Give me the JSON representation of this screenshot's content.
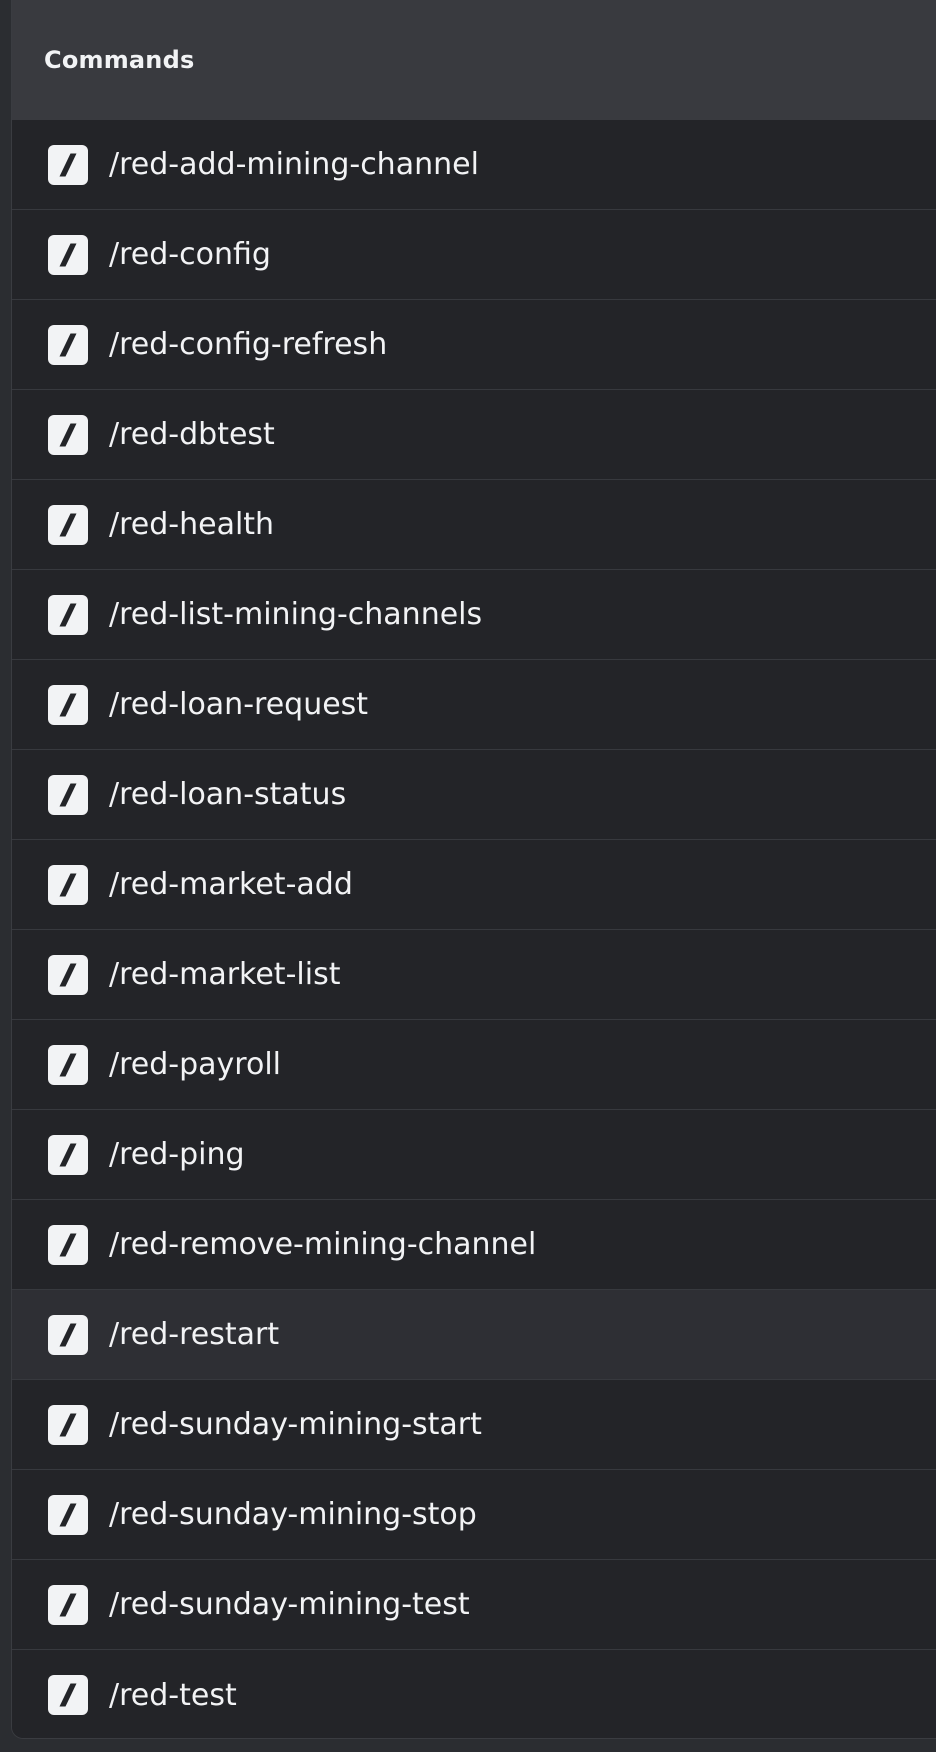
{
  "panel": {
    "title": "Commands"
  },
  "commands": [
    {
      "name": "/red-add-mining-channel",
      "icon": "slash-command-icon"
    },
    {
      "name": "/red-config",
      "icon": "slash-command-icon"
    },
    {
      "name": "/red-config-refresh",
      "icon": "slash-command-icon"
    },
    {
      "name": "/red-dbtest",
      "icon": "slash-command-icon"
    },
    {
      "name": "/red-health",
      "icon": "slash-command-icon"
    },
    {
      "name": "/red-list-mining-channels",
      "icon": "slash-command-icon"
    },
    {
      "name": "/red-loan-request",
      "icon": "slash-command-icon"
    },
    {
      "name": "/red-loan-status",
      "icon": "slash-command-icon"
    },
    {
      "name": "/red-market-add",
      "icon": "slash-command-icon"
    },
    {
      "name": "/red-market-list",
      "icon": "slash-command-icon"
    },
    {
      "name": "/red-payroll",
      "icon": "slash-command-icon"
    },
    {
      "name": "/red-ping",
      "icon": "slash-command-icon"
    },
    {
      "name": "/red-remove-mining-channel",
      "icon": "slash-command-icon"
    },
    {
      "name": "/red-restart",
      "icon": "slash-command-icon",
      "hovered": true
    },
    {
      "name": "/red-sunday-mining-start",
      "icon": "slash-command-icon"
    },
    {
      "name": "/red-sunday-mining-stop",
      "icon": "slash-command-icon"
    },
    {
      "name": "/red-sunday-mining-test",
      "icon": "slash-command-icon"
    },
    {
      "name": "/red-test",
      "icon": "slash-command-icon"
    }
  ],
  "colors": {
    "panel_bg": "#232428",
    "header_bg": "#393a3f",
    "hover_bg": "#2e2f34",
    "text": "#f2f3f5",
    "icon_bg": "#f2f3f5",
    "icon_glyph": "#232428"
  }
}
